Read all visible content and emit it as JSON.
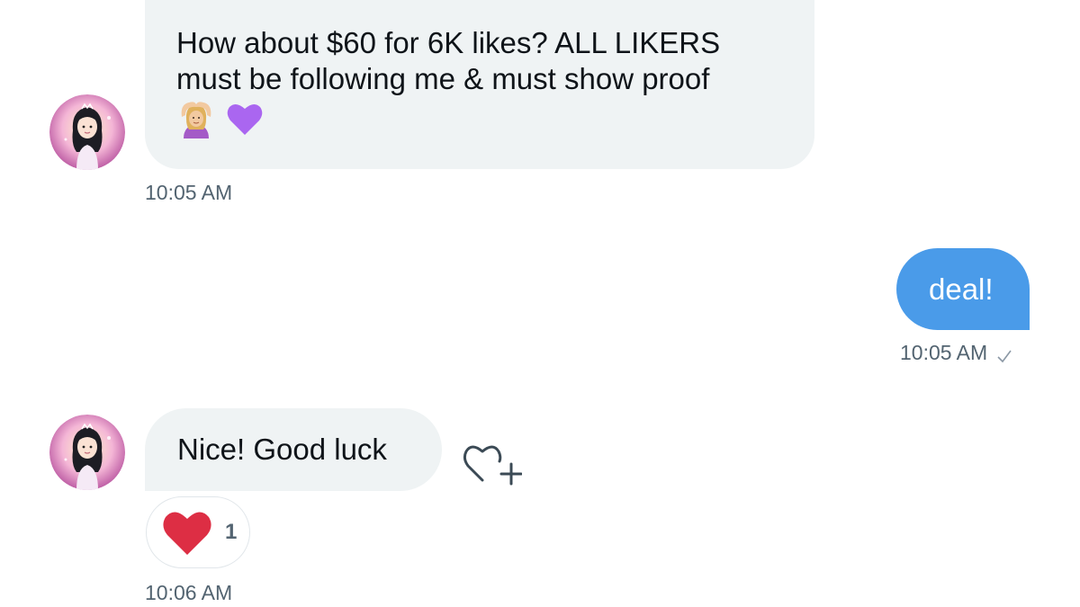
{
  "messages": [
    {
      "direction": "incoming",
      "lines": [
        "How about $60 for 6K likes? ALL LIKERS",
        "must be following me & must show proof"
      ],
      "emojis": [
        "woman-gesturing-ok-icon",
        "purple-heart-icon"
      ],
      "time": "10:05 AM"
    },
    {
      "direction": "outgoing",
      "text": "deal!",
      "time": "10:05 AM",
      "status": "sent-check-icon"
    },
    {
      "direction": "incoming",
      "text": "Nice! Good luck",
      "reaction": {
        "icon": "red-heart-icon",
        "count": "1"
      },
      "time": "10:06 AM"
    }
  ],
  "colors": {
    "incoming_bubble": "#eff3f4",
    "outgoing_bubble": "#4a9be9",
    "timestamp": "#536471",
    "reaction_heart": "#dd2e44",
    "purple_heart": "#aa66f0"
  }
}
